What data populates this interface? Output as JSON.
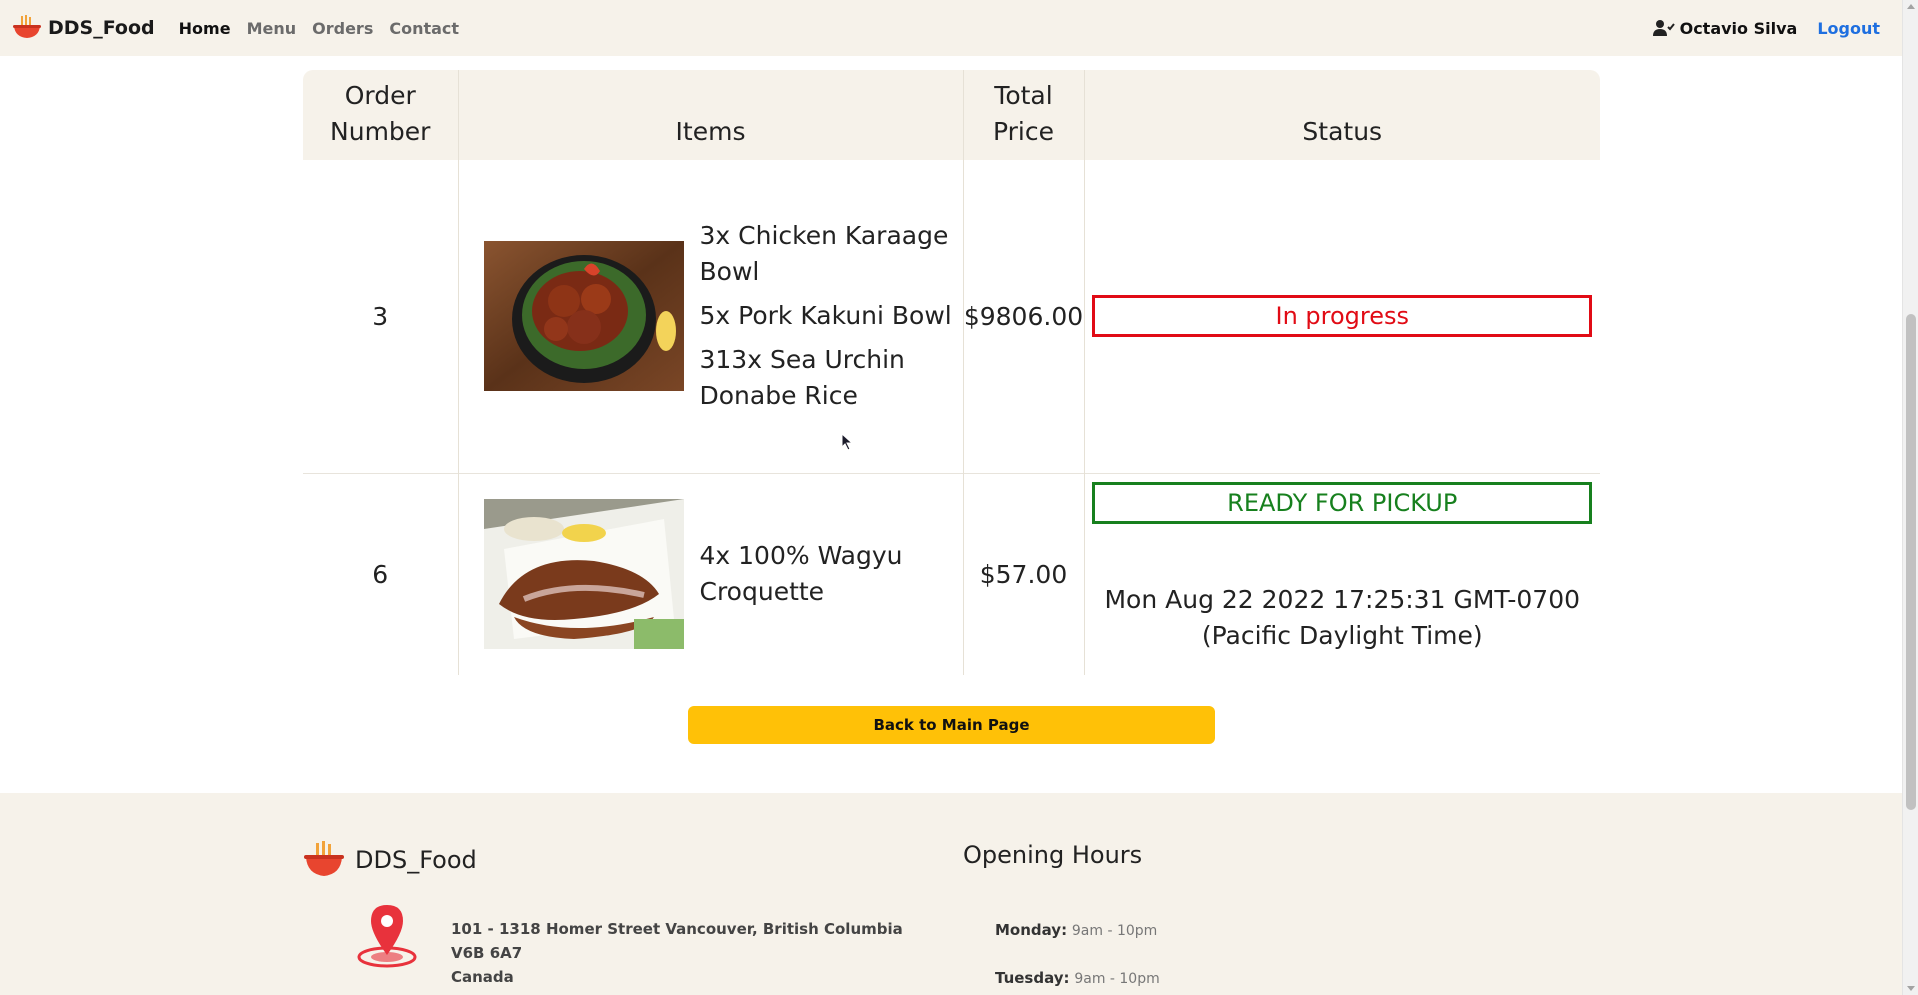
{
  "navbar": {
    "brand": "DDS_Food",
    "links": [
      "Home",
      "Menu",
      "Orders",
      "Contact"
    ],
    "user_name": "Octavio Silva",
    "logout": "Logout"
  },
  "table": {
    "headers": {
      "order_number": "Order Number",
      "items": "Items",
      "total_price": "Total Price",
      "status": "Status"
    },
    "orders": [
      {
        "number": "3",
        "items": [
          "3x Chicken Karaage Bowl",
          "5x Pork Kakuni Bowl",
          "313x Sea Urchin Donabe Rice"
        ],
        "total": "$9806.00",
        "status": "In progress",
        "pickup_time": ""
      },
      {
        "number": "6",
        "items": [
          "4x 100% Wagyu Croquette"
        ],
        "total": "$57.00",
        "status": "READY FOR PICKUP",
        "pickup_time": "Mon Aug 22 2022 17:25:31 GMT-0700 (Pacific Daylight Time)"
      }
    ]
  },
  "back_button": "Back to Main Page",
  "footer": {
    "brand": "DDS_Food",
    "address_line1": "101 - 1318 Homer Street Vancouver, British Columbia V6B 6A7",
    "address_line2": "Canada",
    "hours_title": "Opening Hours",
    "hours": [
      {
        "day": "Monday:",
        "time": "9am - 10pm"
      },
      {
        "day": "Tuesday:",
        "time": "9am - 10pm"
      }
    ]
  },
  "colors": {
    "accent_yellow": "#ffc107",
    "status_red": "#e10b15",
    "status_green": "#17801e",
    "logout_blue": "#1e6fe0",
    "panel_beige": "#f6f2ea"
  }
}
